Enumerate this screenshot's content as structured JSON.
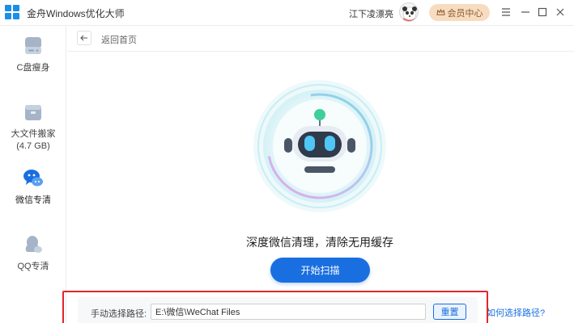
{
  "window": {
    "title": "金舟Windows优化大师",
    "username": "江下凌漂亮",
    "member_label": "会员中心",
    "accent_color": "#1a6fe0",
    "member_bg": "#f7dcc0",
    "outline_color": "#e3262b"
  },
  "sidebar": {
    "items": [
      {
        "label": "C盘瘦身",
        "icon": "disk-icon"
      },
      {
        "label": "大文件搬家",
        "sublabel": "(4.7 GB)",
        "icon": "file-box-icon"
      },
      {
        "label": "微信专清",
        "icon": "wechat-clean-icon",
        "active": true
      },
      {
        "label": "QQ专清",
        "icon": "qq-clean-icon"
      }
    ]
  },
  "header": {
    "back_label": "返回首页"
  },
  "main": {
    "message": "深度微信清理，清除无用缓存",
    "scan_button": "开始扫描"
  },
  "path": {
    "label": "手动选择路径:",
    "value": "E:\\微信\\WeChat Files",
    "reset_label": "重置",
    "help_link": "如何选择路径?"
  }
}
